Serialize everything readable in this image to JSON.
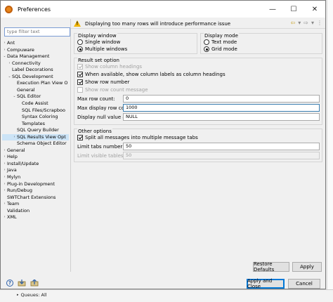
{
  "window": {
    "title": "Preferences",
    "minimize": "—",
    "maximize": "☐",
    "close": "✕"
  },
  "filter": {
    "placeholder": "type filter text"
  },
  "tree": [
    {
      "label": "Ant",
      "level": 1,
      "twisty": "›"
    },
    {
      "label": "Compuware",
      "level": 1,
      "twisty": "›"
    },
    {
      "label": "Data Management",
      "level": 1,
      "twisty": "⌄"
    },
    {
      "label": "Connectivity",
      "level": 2,
      "twisty": "›"
    },
    {
      "label": "Label Decorations",
      "level": 2,
      "twisty": ""
    },
    {
      "label": "SQL Development",
      "level": 2,
      "twisty": "⌄"
    },
    {
      "label": "Execution Plan View O",
      "level": 3,
      "twisty": ""
    },
    {
      "label": "General",
      "level": 3,
      "twisty": ""
    },
    {
      "label": "SQL Editor",
      "level": 3,
      "twisty": "⌄"
    },
    {
      "label": "Code Assist",
      "level": 4,
      "twisty": ""
    },
    {
      "label": "SQL Files/Scrapboo",
      "level": 4,
      "twisty": ""
    },
    {
      "label": "Syntax Coloring",
      "level": 4,
      "twisty": ""
    },
    {
      "label": "Templates",
      "level": 4,
      "twisty": ""
    },
    {
      "label": "SQL Query Builder",
      "level": 3,
      "twisty": ""
    },
    {
      "label": "SQL Results View Opt",
      "level": 3,
      "twisty": "›",
      "selected": true
    },
    {
      "label": "Schema Object Editor",
      "level": 3,
      "twisty": ""
    },
    {
      "label": "General",
      "level": 1,
      "twisty": "›"
    },
    {
      "label": "Help",
      "level": 1,
      "twisty": "›"
    },
    {
      "label": "Install/Update",
      "level": 1,
      "twisty": "›"
    },
    {
      "label": "Java",
      "level": 1,
      "twisty": "›"
    },
    {
      "label": "Mylyn",
      "level": 1,
      "twisty": "›"
    },
    {
      "label": "Plug-in Development",
      "level": 1,
      "twisty": "›"
    },
    {
      "label": "Run/Debug",
      "level": 1,
      "twisty": "›"
    },
    {
      "label": "SWTChart Extensions",
      "level": 1,
      "twisty": ""
    },
    {
      "label": "Team",
      "level": 1,
      "twisty": "›"
    },
    {
      "label": "Validation",
      "level": 1,
      "twisty": ""
    },
    {
      "label": "XML",
      "level": 1,
      "twisty": "›"
    }
  ],
  "message": "Displaying too many rows will introduce performance issue",
  "nav": {
    "back": "⇦",
    "back_menu": "▾",
    "forward": "⇨",
    "forward_menu": "▾",
    "menu": "⋮"
  },
  "display_window": {
    "legend": "Display window",
    "single": "Single window",
    "multiple": "Multiple windows"
  },
  "display_mode": {
    "legend": "Display mode",
    "text": "Text mode",
    "grid": "Grid mode"
  },
  "result_set": {
    "legend": "Result set option",
    "show_column_headings": "Show column headings",
    "show_column_labels": "When available, show column labels as column headings",
    "show_row_number": "Show row number",
    "show_row_count": "Show row count message",
    "max_row_count_label": "Max row count:",
    "max_row_count": "0",
    "max_display_label": "Max display row count:",
    "max_display": "1000",
    "null_label": "Display null value as:",
    "null_value": "NULL"
  },
  "other": {
    "legend": "Other options",
    "split": "Split all messages into multiple message tabs",
    "limit_tabs_label": "Limit tabs number to:",
    "limit_tabs": "50",
    "limit_visible_label": "Limit visible tables to:",
    "limit_visible": "50"
  },
  "buttons": {
    "restore": "Restore Defaults",
    "apply": "Apply",
    "apply_close": "Apply and Close",
    "cancel": "Cancel"
  },
  "background": {
    "queues": "Queues: All"
  },
  "colors": {
    "selection": "#cce4f7",
    "accent": "#0078d7",
    "warning": "#f0b400"
  }
}
